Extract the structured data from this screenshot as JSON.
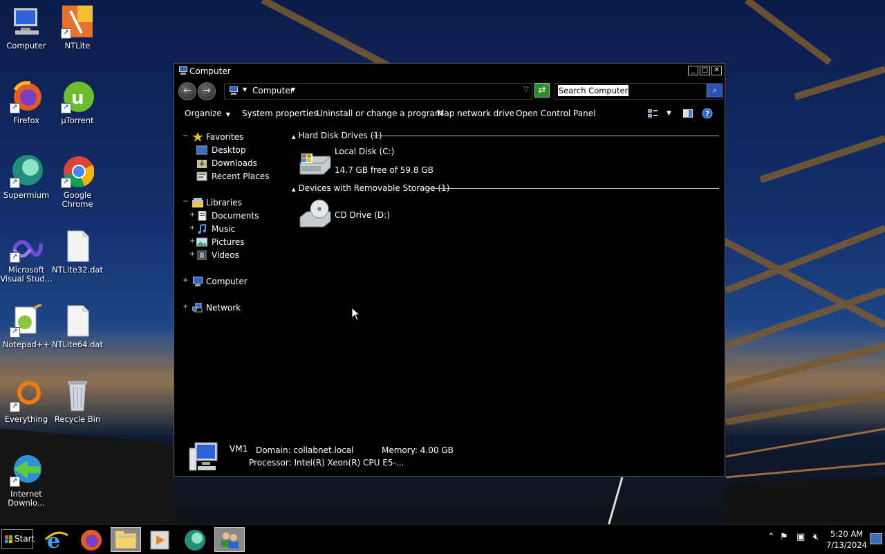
{
  "desktop": {
    "icons": [
      {
        "label": "Computer",
        "icon": "computer-icon"
      },
      {
        "label": "NTLite",
        "icon": "ntlite-icon"
      },
      {
        "label": "Firefox",
        "icon": "firefox-icon"
      },
      {
        "label": "µTorrent",
        "icon": "utorrent-icon"
      },
      {
        "label": "Supermium",
        "icon": "supermium-icon"
      },
      {
        "label": "Google Chrome",
        "icon": "chrome-icon"
      },
      {
        "label": "Microsoft Visual Stud...",
        "icon": "visual-studio-icon"
      },
      {
        "label": "NTLite32.dat",
        "icon": "file-icon"
      },
      {
        "label": "Notepad++",
        "icon": "notepadpp-icon"
      },
      {
        "label": "NTLite64.dat",
        "icon": "file-icon"
      },
      {
        "label": "Everything",
        "icon": "everything-icon"
      },
      {
        "label": "Recycle Bin",
        "icon": "recycle-bin-icon"
      },
      {
        "label": "Internet Downlo...",
        "icon": "idm-icon"
      }
    ]
  },
  "window": {
    "title": "Computer",
    "address": {
      "crumb": "Computer"
    },
    "search": {
      "placeholder": "Search Computer"
    },
    "toolbar": {
      "organize": "Organize",
      "system_properties": "System properties",
      "uninstall": "Uninstall or change a program",
      "map_drive": "Map network drive",
      "control_panel": "Open Control Panel"
    },
    "nav": {
      "favorites": "Favorites",
      "desktop": "Desktop",
      "downloads": "Downloads",
      "recent": "Recent Places",
      "libraries": "Libraries",
      "documents": "Documents",
      "music": "Music",
      "pictures": "Pictures",
      "videos": "Videos",
      "computer": "Computer",
      "network": "Network"
    },
    "groups": {
      "hdd": "Hard Disk Drives (1)",
      "removable": "Devices with Removable Storage (1)"
    },
    "drives": {
      "c_name": "Local Disk (C:)",
      "c_free": "14.7 GB free of 59.8 GB",
      "d_name": "CD Drive (D:)"
    },
    "details": {
      "name": "VM1",
      "domain": "Domain: collabnet.local",
      "memory": "Memory: 4.00 GB",
      "processor": "Processor: Intel(R) Xeon(R) CPU E5-..."
    }
  },
  "taskbar": {
    "start": "Start",
    "time": "5:20 AM",
    "date": "7/13/2024"
  }
}
